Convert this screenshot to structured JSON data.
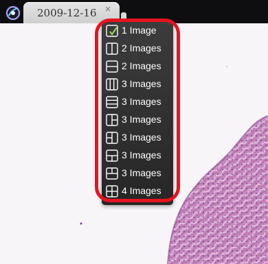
{
  "tab": {
    "title": "2009-12-16",
    "close_glyph": "×",
    "icon": "app-logo-icon"
  },
  "menu": {
    "items": [
      {
        "label": "1 Image",
        "icon": "layout-single-icon",
        "selected": true
      },
      {
        "label": "2 Images",
        "icon": "layout-split-vertical-icon"
      },
      {
        "label": "2 Images",
        "icon": "layout-split-horizontal-icon"
      },
      {
        "label": "3 Images",
        "icon": "layout-three-columns-icon"
      },
      {
        "label": "3 Images",
        "icon": "layout-three-rows-icon"
      },
      {
        "label": "3 Images",
        "icon": "layout-left-plus-two-right-icon"
      },
      {
        "label": "3 Images",
        "icon": "layout-two-left-plus-right-icon"
      },
      {
        "label": "3 Images",
        "icon": "layout-top-plus-two-bottom-icon"
      },
      {
        "label": "3 Images",
        "icon": "layout-two-top-plus-bottom-icon"
      },
      {
        "label": "4 Images",
        "icon": "layout-grid-four-icon"
      }
    ]
  },
  "colors": {
    "menu_bg": "#2f2f2f",
    "highlight_ring": "#e8131f",
    "checkmark": "#9bd35a",
    "tissue": "#c07fb6"
  }
}
